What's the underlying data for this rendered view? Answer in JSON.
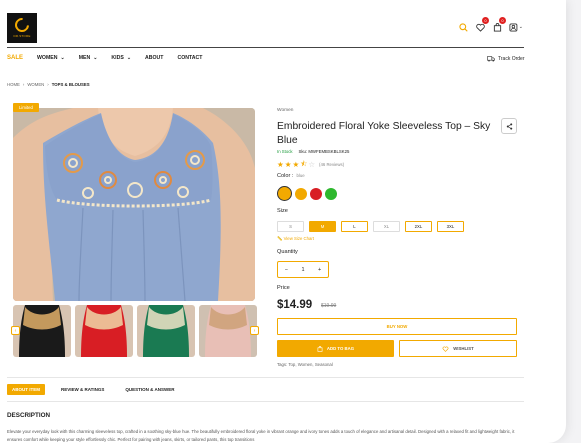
{
  "header": {
    "logo_text": "DR.STORE",
    "cart_count": "0",
    "wishlist_count": "0",
    "track_order": "Track Order"
  },
  "nav": {
    "sale": "SALE",
    "items": [
      {
        "label": "WOMEN",
        "dropdown": true
      },
      {
        "label": "MEN",
        "dropdown": true
      },
      {
        "label": "KIDS",
        "dropdown": true
      },
      {
        "label": "ABOUT",
        "dropdown": false
      },
      {
        "label": "CONTACT",
        "dropdown": false
      }
    ]
  },
  "breadcrumb": [
    "HOME",
    "WOMEN",
    "TOPS & BLOUSES"
  ],
  "gallery": {
    "badge": "Limited",
    "thumbnail_colors": [
      "#1a1a1a",
      "#d81e24",
      "#1a7a52",
      "#e8bfb6"
    ]
  },
  "product": {
    "category": "Women",
    "title": "Embroidered Floral Yoke Sleeveless Top – Sky Blue",
    "stock": "In Stock",
    "sku": "Sku: MWFEMBSKBLSK25",
    "rating": 3.5,
    "reviews": "(46 Reviews)",
    "color_label": "Color :",
    "color_value": "blue",
    "colors": [
      "#f2a900",
      "#f2a900",
      "#d81e24",
      "#2eb82e"
    ],
    "size_label": "Size",
    "sizes": [
      {
        "label": "S",
        "state": "disabled"
      },
      {
        "label": "M",
        "state": "active"
      },
      {
        "label": "L",
        "state": "normal"
      },
      {
        "label": "XL",
        "state": "disabled"
      },
      {
        "label": "2XL",
        "state": "normal"
      },
      {
        "label": "3XL",
        "state": "normal"
      }
    ],
    "size_chart": "View Size Chart",
    "quantity_label": "Quantity",
    "quantity": "1",
    "price_label": "Price",
    "price": "$14.99",
    "old_price": "$19.99",
    "buy_now": "BUY NOW",
    "add_to_bag": "ADD TO BAG",
    "wishlist": "WISHLIST",
    "tags": "Tags: Top, Women, Seasonal"
  },
  "tabs": [
    "ABOUT ITEM",
    "REVIEW & RATINGS",
    "QUESTION & ANSWER"
  ],
  "description": {
    "heading": "DESCRIPTION",
    "text": "Elevate your everyday look with this charming sleeveless top, crafted in a soothing sky-blue hue. The beautifully embroidered floral yoke in vibrant orange and ivory tones adds a touch of elegance and artisanal detail. Designed with a relaxed fit and lightweight fabric, it ensures comfort while keeping your style effortlessly chic. Perfect for pairing with jeans, skirts, or tailored pants, this top transitions"
  },
  "colors": {
    "accent": "#f2a900",
    "badge_red": "#e02020",
    "stock_green": "#1a9a3a"
  }
}
